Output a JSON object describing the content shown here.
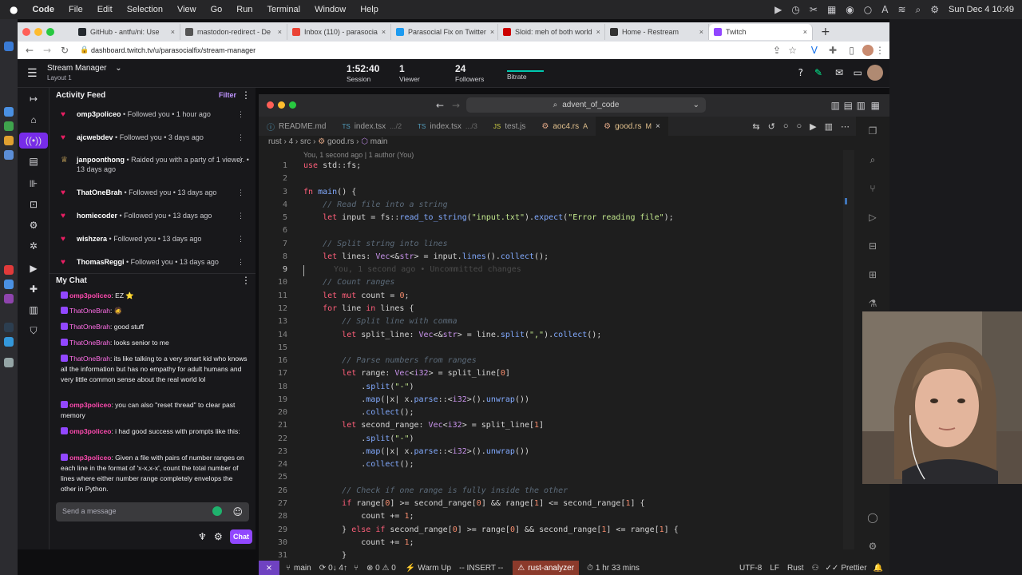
{
  "menubar": {
    "app": "Code",
    "items": [
      "File",
      "Edit",
      "Selection",
      "View",
      "Go",
      "Run",
      "Terminal",
      "Window",
      "Help"
    ],
    "datetime": "Sun Dec 4  10:49"
  },
  "browser": {
    "tabs": [
      {
        "label": "GitHub - antfu/ni: Use",
        "color": "#24292e"
      },
      {
        "label": "mastodon-redirect - De",
        "color": "#555555"
      },
      {
        "label": "Inbox (110) - parasocia",
        "color": "#ea4335"
      },
      {
        "label": "Parasocial Fix on Twitter",
        "color": "#1d9bf0"
      },
      {
        "label": "Sloid: meh of both world",
        "color": "#cc0000"
      },
      {
        "label": "Home - Restream",
        "color": "#333333"
      },
      {
        "label": "Twitch",
        "color": "#9146ff"
      }
    ],
    "url": "dashboard.twitch.tv/u/parasocialfix/stream-manager"
  },
  "twitch": {
    "title": "Stream Manager",
    "layout": "Layout 1",
    "stats": [
      {
        "value": "1:52:40",
        "label": "Session"
      },
      {
        "value": "1",
        "label": "Viewer"
      },
      {
        "value": "24",
        "label": "Followers"
      },
      {
        "value": "",
        "label": "Bitrate"
      }
    ],
    "activity": {
      "title": "Activity Feed",
      "filter": "Filter",
      "items": [
        {
          "name": "omp3policeo",
          "action": "Followed you",
          "time": "1 hour ago"
        },
        {
          "name": "ajcwebdev",
          "action": "Followed you",
          "time": "3 days ago"
        },
        {
          "name": "janpoonthong",
          "action": "Raided you with a party of 1 viewer.",
          "time": "13 days ago"
        },
        {
          "name": "ThatOneBrah",
          "action": "Followed you",
          "time": "13 days ago"
        },
        {
          "name": "homiecoder",
          "action": "Followed you",
          "time": "13 days ago"
        },
        {
          "name": "wishzera",
          "action": "Followed you",
          "time": "13 days ago"
        },
        {
          "name": "ThomasReggi",
          "action": "Followed you",
          "time": "13 days ago"
        }
      ]
    },
    "chat": {
      "title": "My Chat",
      "messages": [
        {
          "user": "omp3policeo",
          "text": "EZ ⭐"
        },
        {
          "user": "ThatOneBrah",
          "text": "🧔"
        },
        {
          "user": "ThatOneBrah",
          "text": "good stuff"
        },
        {
          "user": "ThatOneBrah",
          "text": "looks senior to me"
        },
        {
          "user": "ThatOneBrah",
          "text": "its like talking to a very smart kid who knows all the information but has no empathy for adult humans and very little common sense about the real world lol"
        },
        {
          "user": "omp3policeo",
          "text": "you can also \"reset thread\" to clear past memory"
        },
        {
          "user": "omp3policeo",
          "text": "i had good success with prompts like this:"
        },
        {
          "user": "omp3policeo",
          "text": "Given a file with pairs of number ranges on each line in the format of 'x-x,x-x', count the total number of lines where either number range completely envelops the other in Python."
        }
      ],
      "placeholder": "Send a message",
      "send": "Chat"
    }
  },
  "vscode": {
    "search": "advent_of_code",
    "tabs": [
      {
        "label": "README.md",
        "sub": ""
      },
      {
        "label": "index.tsx",
        "sub": ".../2"
      },
      {
        "label": "index.tsx",
        "sub": ".../3"
      },
      {
        "label": "test.js",
        "sub": ""
      },
      {
        "label": "aoc4.rs",
        "sub": "A"
      },
      {
        "label": "good.rs",
        "sub": "M"
      }
    ],
    "breadcrumb": [
      "rust",
      "4",
      "src",
      "good.rs",
      "main"
    ],
    "blame_header": "You, 1 second ago | 1 author (You)",
    "blame_inline": "You, 1 second ago • Uncommitted changes",
    "lines": [
      "use std::fs;",
      "",
      "fn main() {",
      "    // Read file into a string",
      "    let input = fs::read_to_string(\"input.txt\").expect(\"Error reading file\");",
      "",
      "    // Split string into lines",
      "    let lines: Vec<&str> = input.lines().collect();",
      "",
      "    // Count ranges",
      "    let mut count = 0;",
      "    for line in lines {",
      "        // Split line with comma",
      "        let split_line: Vec<&str> = line.split(\",\").collect();",
      "",
      "        // Parse numbers from ranges",
      "        let range: Vec<i32> = split_line[0]",
      "            .split(\"-\")",
      "            .map(|x| x.parse::<i32>().unwrap())",
      "            .collect();",
      "        let second_range: Vec<i32> = split_line[1]",
      "            .split(\"-\")",
      "            .map(|x| x.parse::<i32>().unwrap())",
      "            .collect();",
      "",
      "        // Check if one range is fully inside the other",
      "        if range[0] >= second_range[0] && range[1] <= second_range[1] {",
      "            count += 1;",
      "        } else if second_range[0] >= range[0] && second_range[1] <= range[1] {",
      "            count += 1;",
      "        }"
    ],
    "status": {
      "branch": "main",
      "sync": "0↓ 4↑",
      "problems": "⊗ 0 ⚠ 0",
      "warmup": "Warm Up",
      "mode": "-- INSERT --",
      "analyzer": "rust-analyzer",
      "timer": "1 hr 33 mins",
      "encoding": "UTF-8",
      "eol": "LF",
      "lang": "Rust",
      "formatter": "Prettier"
    }
  }
}
